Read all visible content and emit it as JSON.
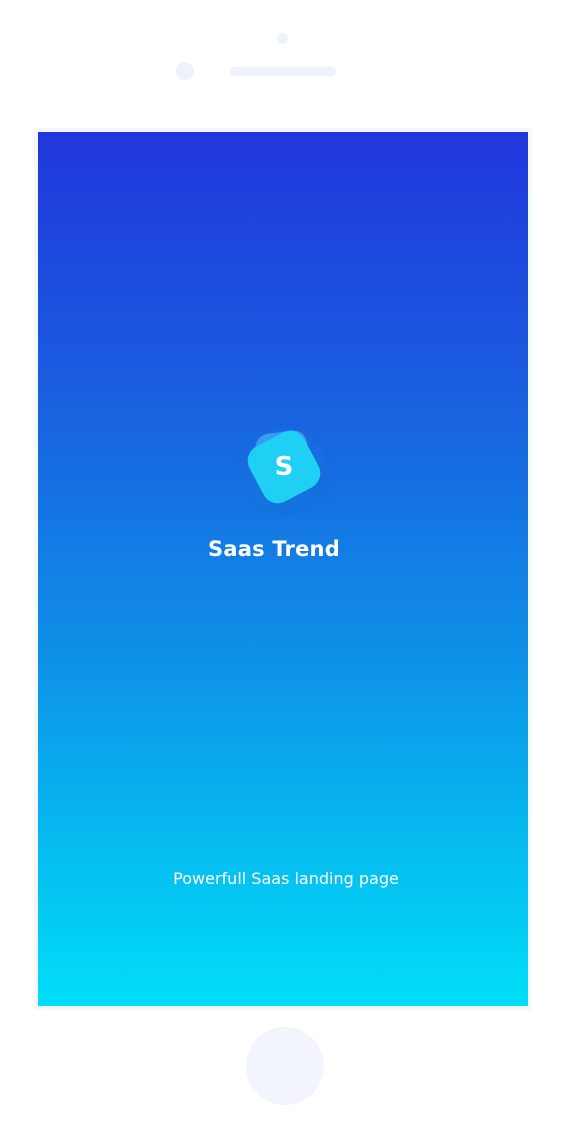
{
  "app": {
    "logo_letter": "S",
    "title": "Saas Trend",
    "tagline": "Powerfull Saas landing page"
  },
  "colors": {
    "gradient_top": "#2036dc",
    "gradient_bottom": "#00def8",
    "logo_tile": "#1fd0f4",
    "text": "#ffffff",
    "device_parts": "#edf2fb"
  },
  "icons": {
    "camera": "camera-dot",
    "sensor": "sensor-dot",
    "speaker": "speaker-grill",
    "home": "home-button"
  }
}
